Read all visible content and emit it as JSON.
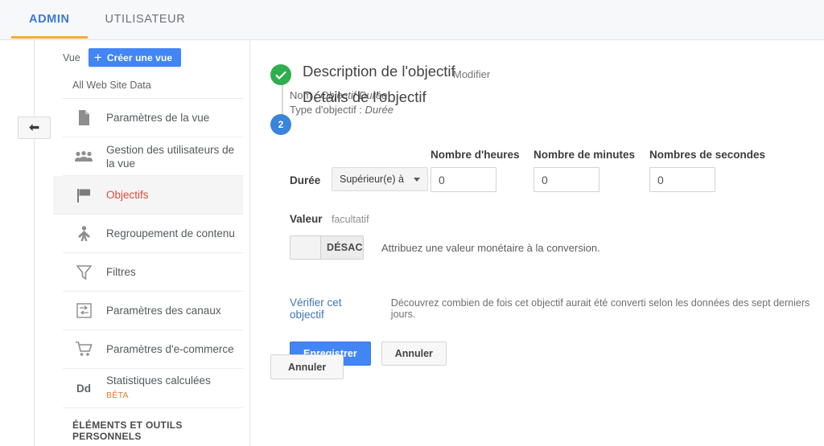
{
  "topbar": {
    "tabs": [
      {
        "label": "ADMIN",
        "active": true
      },
      {
        "label": "UTILISATEUR",
        "active": false
      }
    ]
  },
  "rail": {
    "back_icon": "back-arrow-icon"
  },
  "sidebar": {
    "view_label": "Vue",
    "create_button": "Créer une vue",
    "create_icon": "plus-icon",
    "view_name": "All Web Site Data",
    "items": [
      {
        "label": "Paramètres de la vue",
        "icon": "document-icon",
        "active": false
      },
      {
        "label": "Gestion des utilisateurs de la vue",
        "icon": "users-icon",
        "active": false
      },
      {
        "label": "Objectifs",
        "icon": "flag-icon",
        "active": true
      },
      {
        "label": "Regroupement de contenu",
        "icon": "content-grouping-icon",
        "active": false
      },
      {
        "label": "Filtres",
        "icon": "funnel-icon",
        "active": false
      },
      {
        "label": "Paramètres des canaux",
        "icon": "channels-icon",
        "active": false
      },
      {
        "label": "Paramètres d'e-commerce",
        "icon": "cart-icon",
        "active": false
      },
      {
        "label": "Statistiques calculées",
        "icon": "dd-icon",
        "badge": "BÊTA",
        "active": false
      }
    ],
    "section_title": "ÉLÉMENTS ET OUTILS PERSONNELS"
  },
  "main": {
    "step1": {
      "status_icon": "check-circle-icon",
      "title": "Description de l'objectif",
      "edit_link": "Modifier",
      "name_line": "Nom : ",
      "name_value": "Objectif Durée",
      "type_line": "Type d'objectif : ",
      "type_value": "Durée"
    },
    "step2": {
      "number": "2",
      "title": "Détails de l'objectif"
    },
    "form": {
      "duration_label": "Durée",
      "operator_value": "Supérieur(e) à",
      "operator_caret": "chevron-down-icon",
      "hours_label": "Nombre d'heures",
      "hours_value": "0",
      "minutes_label": "Nombre de minutes",
      "minutes_value": "0",
      "seconds_label": "Nombres de secondes",
      "seconds_value": "0",
      "value_title": "Valeur",
      "value_optional": "facultatif",
      "toggle_state": "DÉSACT",
      "toggle_desc": "Attribuez une valeur monétaire à la conversion."
    },
    "verify": {
      "link": "Vérifier cet objectif",
      "description": "Découvrez combien de fois cet objectif aurait été converti selon les données des sept derniers jours."
    },
    "actions": {
      "save": "Enregistrer",
      "cancel": "Annuler",
      "cancel_bottom": "Annuler"
    }
  },
  "colors": {
    "accent_blue": "#4285f4",
    "tab_active": "#3c78d8",
    "tab_underline": "#f4a93d",
    "active_item_red": "#dd4b39",
    "success_green": "#2eaf4e",
    "step_blue": "#3a84d9",
    "beta_orange": "#e8772e"
  }
}
